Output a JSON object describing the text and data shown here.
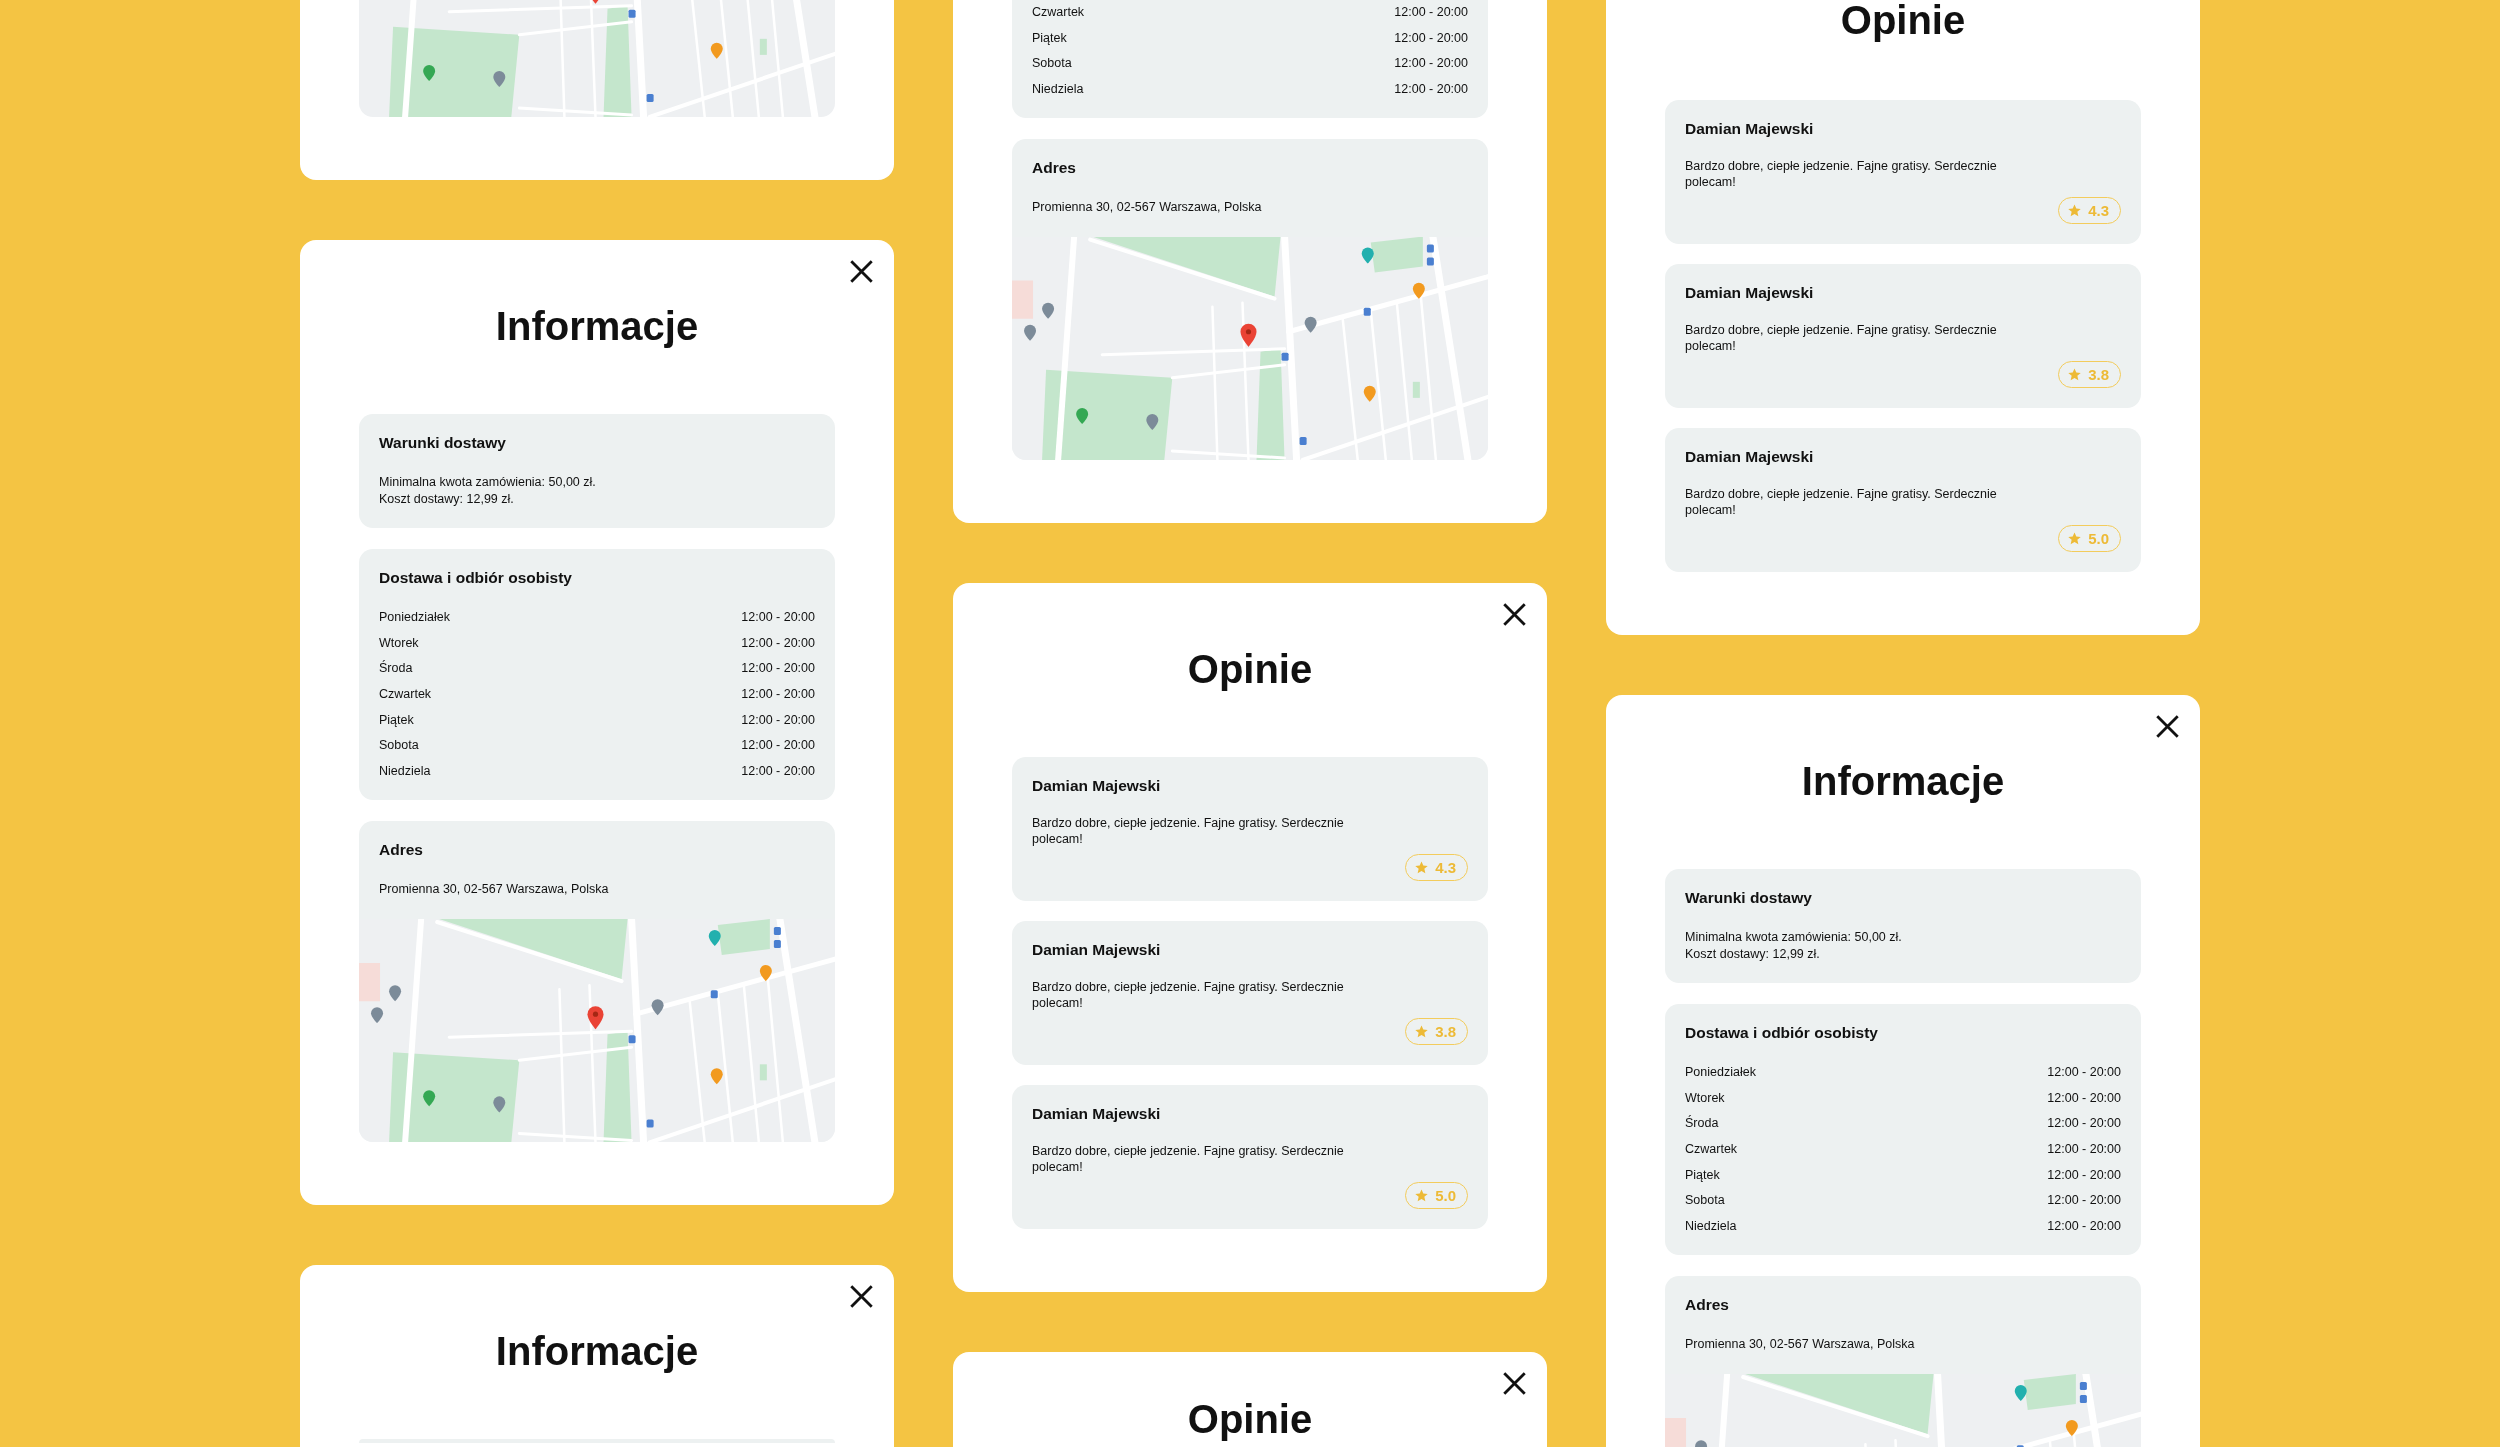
{
  "columns": [
    {
      "cards": [
        {
          "kind": "info",
          "sections": [
            {
              "kind": "address"
            }
          ]
        },
        {
          "kind": "info",
          "close_button": true,
          "title": "Informacje",
          "sections": [
            {
              "kind": "conditions",
              "title": "Warunki dostawy",
              "lines": [
                "Minimalna kwota zamówienia: 50,00 zł.",
                "Koszt dostawy: 12,99 zł."
              ]
            },
            {
              "kind": "hours",
              "title": "Dostawa i odbiór osobisty",
              "rows": [
                {
                  "day": "Poniedziałek",
                  "hours": "12:00 - 20:00"
                },
                {
                  "day": "Wtorek",
                  "hours": "12:00 - 20:00"
                },
                {
                  "day": "Środa",
                  "hours": "12:00 - 20:00"
                },
                {
                  "day": "Czwartek",
                  "hours": "12:00 - 20:00"
                },
                {
                  "day": "Piątek",
                  "hours": "12:00 - 20:00"
                },
                {
                  "day": "Sobota",
                  "hours": "12:00 - 20:00"
                },
                {
                  "day": "Niedziela",
                  "hours": "12:00 - 20:00"
                }
              ]
            },
            {
              "kind": "address",
              "title": "Adres",
              "address": "Promienna 30, 02-567 Warszawa, Polska"
            }
          ]
        },
        {
          "kind": "info",
          "close_button": true,
          "title": "Informacje",
          "sections": [
            {
              "kind": "conditions"
            }
          ]
        }
      ]
    },
    {
      "cards": [
        {
          "kind": "info",
          "sections": [
            {
              "kind": "hours",
              "rows": [
                {
                  "day": "Czwartek",
                  "hours": "12:00 - 20:00"
                },
                {
                  "day": "Piątek",
                  "hours": "12:00 - 20:00"
                },
                {
                  "day": "Sobota",
                  "hours": "12:00 - 20:00"
                },
                {
                  "day": "Niedziela",
                  "hours": "12:00 - 20:00"
                }
              ]
            },
            {
              "kind": "address",
              "title": "Adres",
              "address": "Promienna 30, 02-567 Warszawa, Polska"
            }
          ]
        },
        {
          "kind": "reviews",
          "close_button": true,
          "title": "Opinie",
          "reviews": [
            {
              "name": "Damian Majewski",
              "comment": "Bardzo dobre, ciepłe jedzenie. Fajne gratisy. Serdecznie polecam!",
              "rating": "4.3"
            },
            {
              "name": "Damian Majewski",
              "comment": "Bardzo dobre, ciepłe jedzenie. Fajne gratisy. Serdecznie polecam!",
              "rating": "3.8"
            },
            {
              "name": "Damian Majewski",
              "comment": "Bardzo dobre, ciepłe jedzenie. Fajne gratisy. Serdecznie polecam!",
              "rating": "5.0"
            }
          ]
        },
        {
          "kind": "reviews",
          "close_button": true,
          "title": "Opinie"
        }
      ]
    },
    {
      "cards": [
        {
          "kind": "reviews",
          "title": "Opinie",
          "reviews": [
            {
              "name": "Damian Majewski",
              "comment": "Bardzo dobre, ciepłe jedzenie. Fajne gratisy. Serdecznie polecam!",
              "rating": "4.3"
            },
            {
              "name": "Damian Majewski",
              "comment": "Bardzo dobre, ciepłe jedzenie. Fajne gratisy. Serdecznie polecam!",
              "rating": "3.8"
            },
            {
              "name": "Damian Majewski",
              "comment": "Bardzo dobre, ciepłe jedzenie. Fajne gratisy. Serdecznie polecam!",
              "rating": "5.0"
            }
          ]
        },
        {
          "kind": "info",
          "close_button": true,
          "title": "Informacje",
          "sections": [
            {
              "kind": "conditions",
              "title": "Warunki dostawy",
              "lines": [
                "Minimalna kwota zamówienia: 50,00 zł.",
                "Koszt dostawy: 12,99 zł."
              ]
            },
            {
              "kind": "hours",
              "title": "Dostawa i odbiór osobisty",
              "rows": [
                {
                  "day": "Poniedziałek",
                  "hours": "12:00 - 20:00"
                },
                {
                  "day": "Wtorek",
                  "hours": "12:00 - 20:00"
                },
                {
                  "day": "Środa",
                  "hours": "12:00 - 20:00"
                },
                {
                  "day": "Czwartek",
                  "hours": "12:00 - 20:00"
                },
                {
                  "day": "Piątek",
                  "hours": "12:00 - 20:00"
                },
                {
                  "day": "Sobota",
                  "hours": "12:00 - 20:00"
                },
                {
                  "day": "Niedziela",
                  "hours": "12:00 - 20:00"
                }
              ]
            },
            {
              "kind": "address",
              "title": "Adres",
              "address": "Promienna 30, 02-567 Warszawa, Polska"
            }
          ]
        }
      ]
    }
  ]
}
